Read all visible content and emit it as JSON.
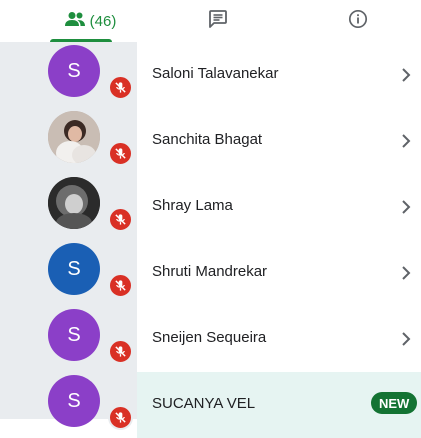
{
  "tabs": {
    "people": {
      "icon": "people-icon",
      "count": "(46)",
      "active": true
    },
    "chat": {
      "icon": "chat-icon"
    },
    "info": {
      "icon": "info-icon"
    }
  },
  "colors": {
    "accent": "#1e8e3e",
    "mute_badge": "#d93025",
    "new_badge": "#137333",
    "highlight_row": "#e6f4f2",
    "rail": "#e9ecef"
  },
  "participants": [
    {
      "name": "Saloni Talavanekar",
      "avatar_type": "letter",
      "initial": "S",
      "avatar_color": "#8b3fc8",
      "muted": true,
      "action_icon": "chevron-right-icon"
    },
    {
      "name": "Sanchita Bhagat",
      "avatar_type": "photo",
      "avatar_color": "#b7a9a0",
      "muted": true,
      "action_icon": "chevron-right-icon"
    },
    {
      "name": "Shray Lama",
      "avatar_type": "photo",
      "avatar_color": "#3a3a3a",
      "muted": true,
      "action_icon": "chevron-right-icon"
    },
    {
      "name": "Shruti Mandrekar",
      "avatar_type": "letter",
      "initial": "S",
      "avatar_color": "#1a5fb4",
      "muted": true,
      "action_icon": "chevron-right-icon"
    },
    {
      "name": "Sneijen Sequeira",
      "avatar_type": "letter",
      "initial": "S",
      "avatar_color": "#8b3fc8",
      "muted": true,
      "action_icon": "chevron-right-icon"
    },
    {
      "name": "SUCANYA VEL",
      "avatar_type": "letter",
      "initial": "S",
      "avatar_color": "#8b3fc8",
      "muted": true,
      "badge": "NEW",
      "highlighted": true
    }
  ]
}
